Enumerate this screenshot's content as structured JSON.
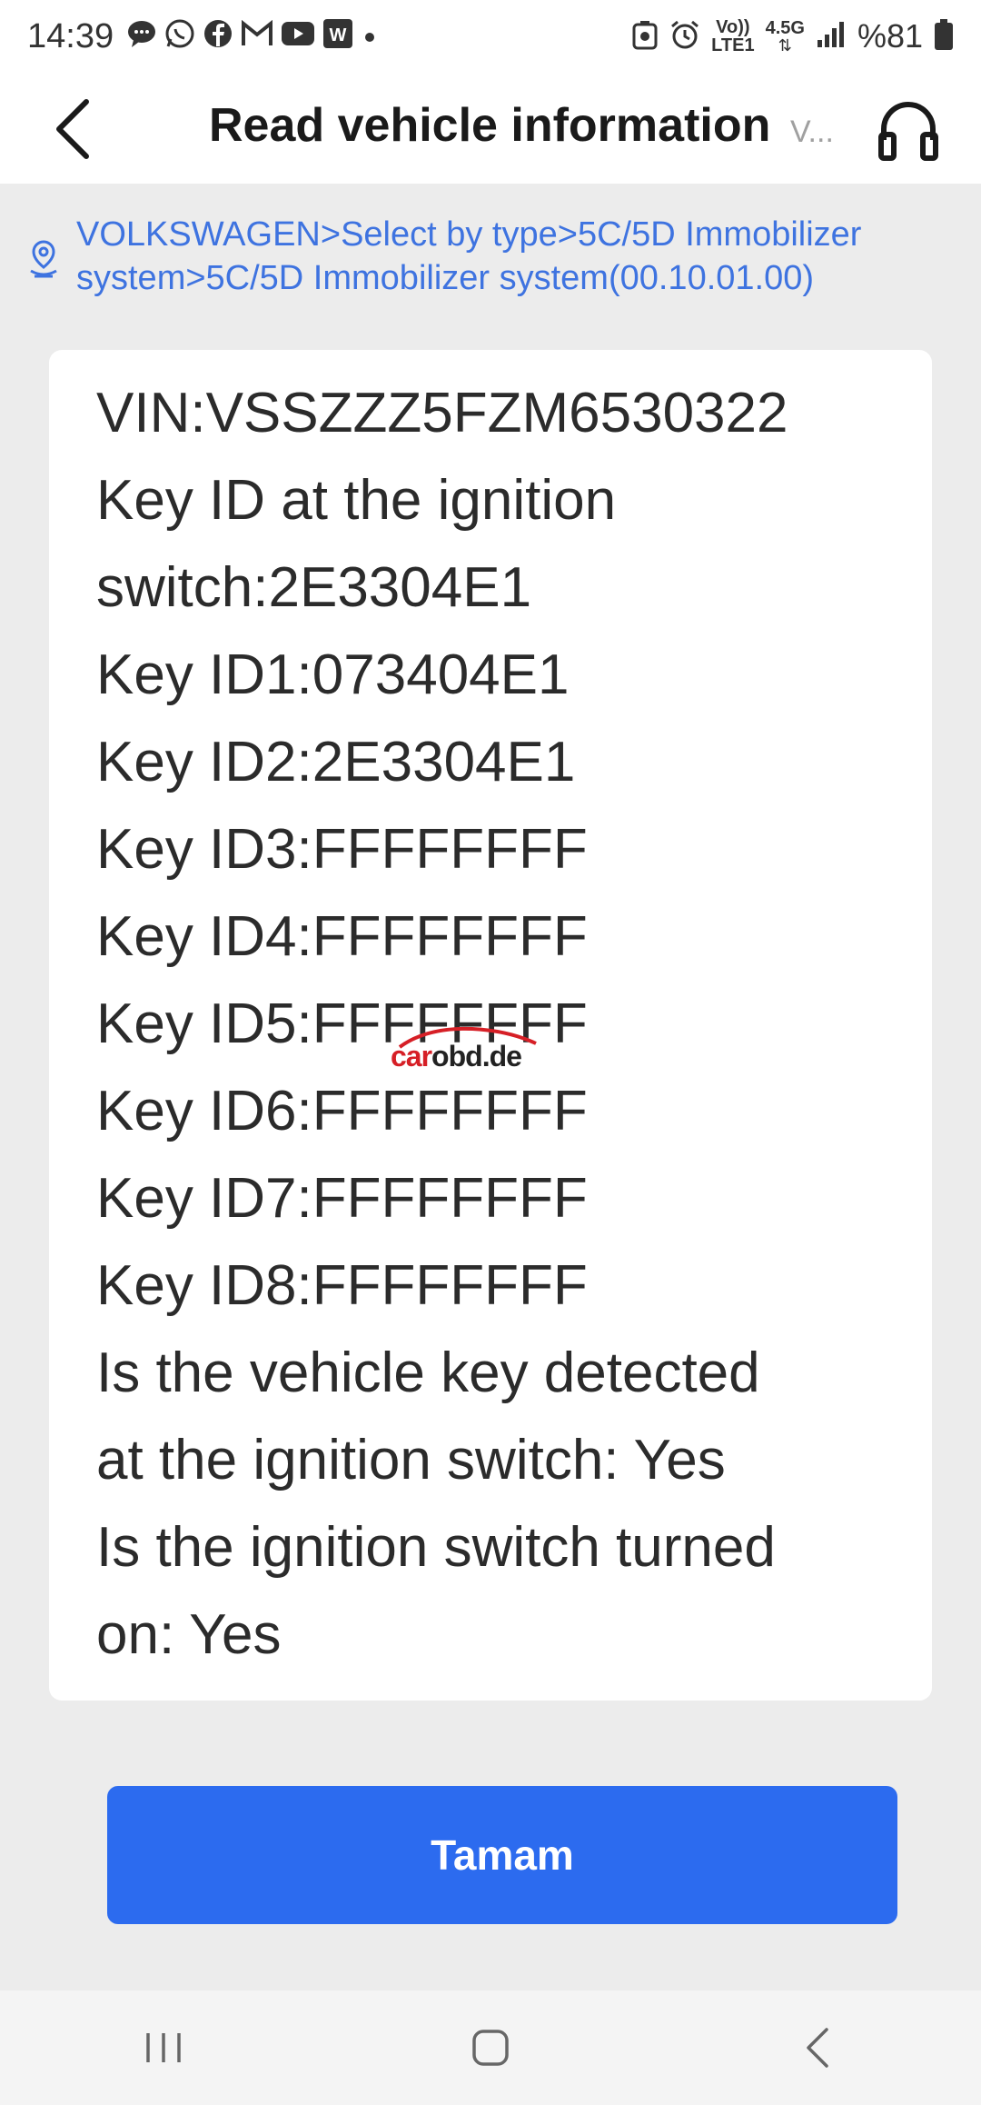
{
  "status_bar": {
    "time": "14:39",
    "notification_icons": [
      "chat-bubble-icon",
      "whatsapp-icon",
      "facebook-icon",
      "gmail-icon",
      "youtube-icon",
      "word-icon",
      "dot-icon"
    ],
    "network_label_top": "Vo))",
    "network_label_bottom": "LTE1",
    "network_type": "4.5G",
    "battery": "%81"
  },
  "header": {
    "title": "Read vehicle information",
    "subtitle": "V..."
  },
  "breadcrumb": {
    "text": "VOLKSWAGEN>Select by type>5C/5D Immobilizer system>5C/5D Immobilizer system(00.10.01.00)"
  },
  "info": {
    "lines": [
      "VIN:VSSZZZ5FZM6530322",
      "Key ID at the ignition",
      "switch:2E3304E1",
      "Key ID1:073404E1",
      "Key ID2:2E3304E1",
      "Key ID3:FFFFFFFF",
      "Key ID4:FFFFFFFF",
      "Key ID5:FFFFFFFF",
      "Key ID6:FFFFFFFF",
      "Key ID7:FFFFFFFF",
      "Key ID8:FFFFFFFF",
      "Is the vehicle key detected",
      "at the ignition switch: Yes",
      "Is the ignition switch turned",
      "on: Yes"
    ]
  },
  "watermark": {
    "text_red": "car",
    "text_dark": "obd.de"
  },
  "actions": {
    "ok_label": "Tamam"
  },
  "colors": {
    "accent": "#2c6bef",
    "breadcrumb": "#3e73e0",
    "background": "#ececec"
  }
}
